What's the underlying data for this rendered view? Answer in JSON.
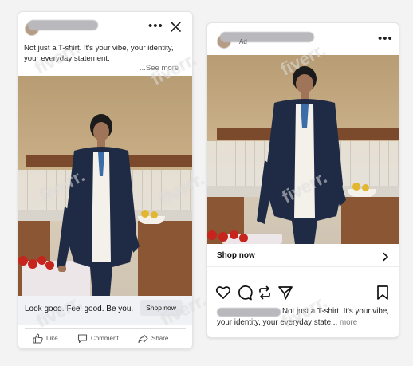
{
  "facebook_ad": {
    "caption": "Not just a T-shirt. It's your vibe, your identity, your everyday statement.",
    "see_more": "...See more",
    "tagline": "Look good. Feel good. Be you.",
    "cta": "Shop now",
    "actions": [
      {
        "label": "Like",
        "icon": "thumbs-up-icon"
      },
      {
        "label": "Comment",
        "icon": "comment-icon"
      },
      {
        "label": "Share",
        "icon": "share-icon"
      }
    ]
  },
  "instagram_ad": {
    "sponsored": "Ad",
    "cta": "Shop now",
    "caption": "Not just a T-shirt. It's your vibe, your identity, your everyday state...",
    "more": "more",
    "icons": [
      "heart-icon",
      "comment-icon",
      "repost-icon",
      "send-icon",
      "bookmark-icon"
    ]
  },
  "watermark": "fiverr.",
  "colors": {
    "shelf": "#7b4a2c",
    "blazer": "#1f2a44",
    "tomato": "#c6241d",
    "wall": "#c8ae86"
  }
}
